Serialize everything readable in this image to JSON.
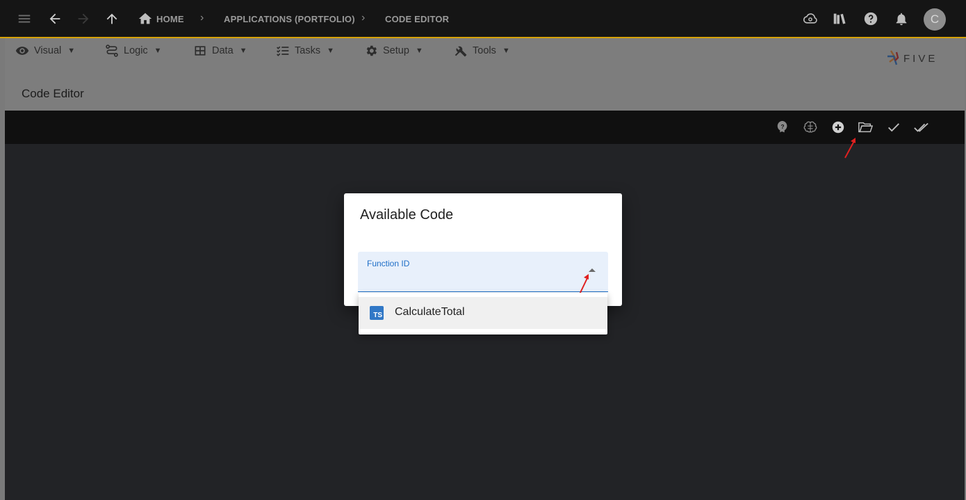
{
  "topbar": {
    "breadcrumbs": [
      "HOME",
      "APPLICATIONS (PORTFOLIO)",
      "CODE EDITOR"
    ],
    "avatar_letter": "C"
  },
  "menu": {
    "items": [
      {
        "label": "Visual",
        "icon": "eye-icon"
      },
      {
        "label": "Logic",
        "icon": "flow-icon"
      },
      {
        "label": "Data",
        "icon": "table-icon"
      },
      {
        "label": "Tasks",
        "icon": "checklist-icon"
      },
      {
        "label": "Setup",
        "icon": "gear-icon"
      },
      {
        "label": "Tools",
        "icon": "tools-icon"
      }
    ],
    "caret": "▼",
    "logo_text": "FIVE"
  },
  "page": {
    "title": "Code Editor"
  },
  "toolbar": {
    "icons": [
      "help-icon",
      "brain-icon",
      "add-icon",
      "open-folder-icon",
      "check-icon",
      "double-check-icon"
    ]
  },
  "dialog": {
    "title": "Available Code",
    "field_label": "Function ID",
    "field_value": "",
    "options": [
      {
        "badge": "TS",
        "label": "CalculateTotal"
      }
    ]
  },
  "colors": {
    "accent_line": "#d6a200",
    "field_blue": "#1e6ec7",
    "ts_blue": "#3178c6",
    "annotation_red": "#e02020"
  }
}
